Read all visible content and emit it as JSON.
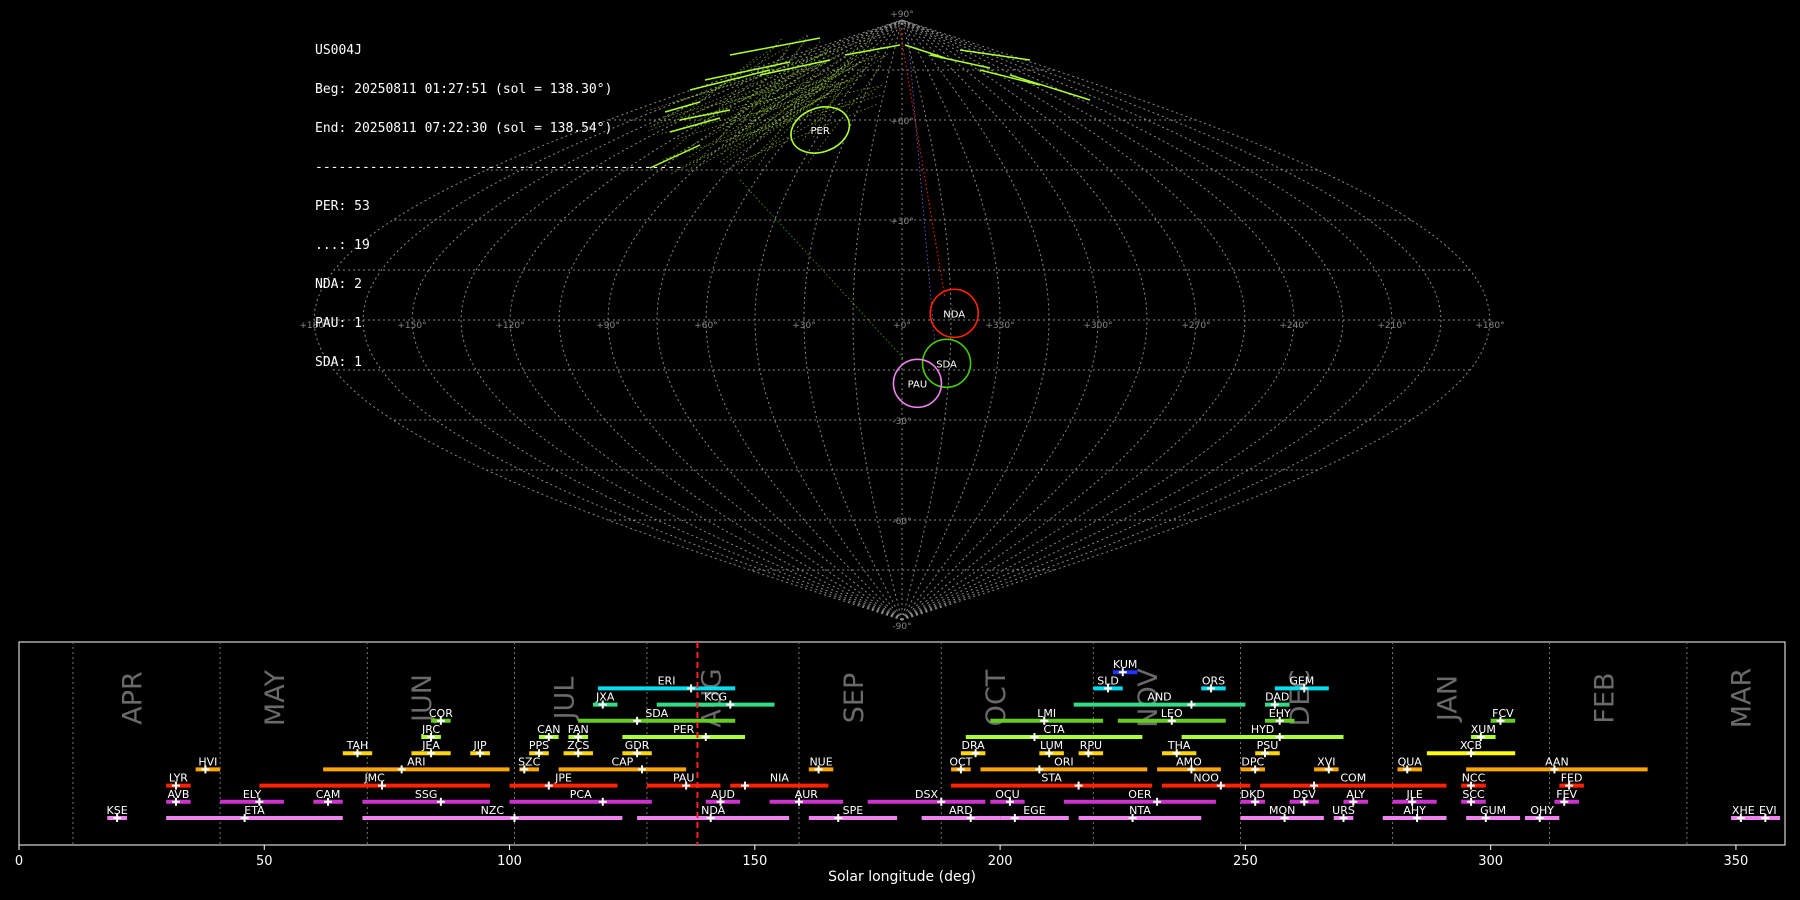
{
  "info": {
    "station": "US004J",
    "begin": "Beg: 20250811 01:27:51 (sol = 138.30°)",
    "end": "End: 20250811 07:22:30 (sol = 138.54°)",
    "separator": "-----------------------------------------------",
    "counts": [
      "PER: 53",
      "...: 19",
      "NDA: 2",
      "PAU: 1",
      "SDA: 1"
    ]
  },
  "sky": {
    "lon_labels": [
      "+180°",
      "+150°",
      "+120°",
      "+90°",
      "+60°",
      "+30°",
      "+0°",
      "+330°",
      "+300°",
      "+270°",
      "+240°",
      "+210°",
      "+180°"
    ],
    "lat_labels": [
      "+90°",
      "+60°",
      "+30°",
      "-30°",
      "-60°",
      "-90°"
    ],
    "radiants": [
      {
        "code": "PER",
        "lon": 46,
        "lat": 57,
        "color": "#adff2f"
      },
      {
        "code": "NDA",
        "lon": -16,
        "lat": 2,
        "color": "#ff2200"
      },
      {
        "code": "SDA",
        "lon": -14,
        "lat": -13,
        "color": "#44cc00"
      },
      {
        "code": "PAU",
        "lon": -5,
        "lat": -19,
        "color": "#ee82ee"
      }
    ]
  },
  "chart_data": {
    "type": "timeline",
    "xlabel": "Solar longitude (deg)",
    "xlim": [
      0,
      360
    ],
    "xticks": [
      0,
      50,
      100,
      150,
      200,
      250,
      300,
      350
    ],
    "current_sol": 138.3,
    "months": [
      {
        "name": "APR",
        "sol": 25
      },
      {
        "name": "MAY",
        "sol": 54
      },
      {
        "name": "JUN",
        "sol": 84
      },
      {
        "name": "JUL",
        "sol": 113
      },
      {
        "name": "AUG",
        "sol": 143
      },
      {
        "name": "SEP",
        "sol": 172
      },
      {
        "name": "OCT",
        "sol": 201
      },
      {
        "name": "NOV",
        "sol": 232
      },
      {
        "name": "DEC",
        "sol": 263
      },
      {
        "name": "JAN",
        "sol": 293
      },
      {
        "name": "FEB",
        "sol": 325
      },
      {
        "name": "MAR",
        "sol": 353
      }
    ],
    "month_dividers": [
      11,
      41,
      71,
      101,
      128,
      159,
      188,
      219,
      249,
      280,
      312,
      340
    ],
    "showers": [
      {
        "code": "KSE",
        "start": 18,
        "end": 22,
        "peak": 20,
        "row": 0,
        "color": "#ee82ee"
      },
      {
        "code": "ETA",
        "start": 30,
        "end": 66,
        "peak": 46,
        "row": 0,
        "color": "#ee82ee"
      },
      {
        "code": "NZC",
        "start": 70,
        "end": 123,
        "peak": 101,
        "row": 0,
        "color": "#ee82ee"
      },
      {
        "code": "NDA",
        "start": 126,
        "end": 157,
        "peak": 141,
        "row": 0,
        "color": "#ee82ee"
      },
      {
        "code": "SPE",
        "start": 161,
        "end": 179,
        "peak": 167,
        "row": 0,
        "color": "#ee82ee"
      },
      {
        "code": "ARD",
        "start": 184,
        "end": 200,
        "peak": 194,
        "row": 0,
        "color": "#ee82ee"
      },
      {
        "code": "EGE",
        "start": 200,
        "end": 214,
        "peak": 203,
        "row": 0,
        "color": "#ee82ee"
      },
      {
        "code": "NTA",
        "start": 216,
        "end": 241,
        "peak": 227,
        "row": 0,
        "color": "#ee82ee"
      },
      {
        "code": "MON",
        "start": 249,
        "end": 266,
        "peak": 258,
        "row": 0,
        "color": "#ee82ee"
      },
      {
        "code": "URS",
        "start": 268,
        "end": 272,
        "peak": 270,
        "row": 0,
        "color": "#ee82ee"
      },
      {
        "code": "AHY",
        "start": 278,
        "end": 291,
        "peak": 285,
        "row": 0,
        "color": "#ee82ee"
      },
      {
        "code": "GUM",
        "start": 295,
        "end": 306,
        "peak": 299,
        "row": 0,
        "color": "#ee82ee"
      },
      {
        "code": "OHY",
        "start": 307,
        "end": 314,
        "peak": 310,
        "row": 0,
        "color": "#ee82ee"
      },
      {
        "code": "XHE",
        "start": 349,
        "end": 354,
        "peak": 351,
        "row": 0,
        "color": "#ee82ee"
      },
      {
        "code": "EVI",
        "start": 354,
        "end": 359,
        "peak": 356,
        "row": 0,
        "color": "#ee82ee"
      },
      {
        "code": "AVB",
        "start": 30,
        "end": 35,
        "peak": 32,
        "row": 1,
        "color": "#cc33cc"
      },
      {
        "code": "ELY",
        "start": 41,
        "end": 54,
        "peak": 49,
        "row": 1,
        "color": "#cc33cc"
      },
      {
        "code": "CAM",
        "start": 60,
        "end": 66,
        "peak": 63,
        "row": 1,
        "color": "#cc33cc"
      },
      {
        "code": "SSG",
        "start": 70,
        "end": 96,
        "peak": 86,
        "row": 1,
        "color": "#cc33cc"
      },
      {
        "code": "PCA",
        "start": 100,
        "end": 129,
        "peak": 119,
        "row": 1,
        "color": "#cc33cc"
      },
      {
        "code": "AUD",
        "start": 140,
        "end": 147,
        "peak": 143,
        "row": 1,
        "color": "#cc33cc"
      },
      {
        "code": "AUR",
        "start": 153,
        "end": 168,
        "peak": 159,
        "row": 1,
        "color": "#cc33cc"
      },
      {
        "code": "DSX",
        "start": 173,
        "end": 197,
        "peak": 188,
        "row": 1,
        "color": "#cc33cc"
      },
      {
        "code": "OCU",
        "start": 198,
        "end": 205,
        "peak": 202,
        "row": 1,
        "color": "#cc33cc"
      },
      {
        "code": "OER",
        "start": 213,
        "end": 244,
        "peak": 232,
        "row": 1,
        "color": "#cc33cc"
      },
      {
        "code": "DKD",
        "start": 249,
        "end": 254,
        "peak": 252,
        "row": 1,
        "color": "#cc33cc"
      },
      {
        "code": "DSV",
        "start": 259,
        "end": 265,
        "peak": 262,
        "row": 1,
        "color": "#cc33cc"
      },
      {
        "code": "ALY",
        "start": 270,
        "end": 275,
        "peak": 272,
        "row": 1,
        "color": "#cc33cc"
      },
      {
        "code": "JLE",
        "start": 280,
        "end": 289,
        "peak": 284,
        "row": 1,
        "color": "#cc33cc"
      },
      {
        "code": "SCC",
        "start": 294,
        "end": 299,
        "peak": 296,
        "row": 1,
        "color": "#cc33cc"
      },
      {
        "code": "FEV",
        "start": 313,
        "end": 318,
        "peak": 315,
        "row": 1,
        "color": "#cc33cc"
      },
      {
        "code": "LYR",
        "start": 30,
        "end": 35,
        "peak": 32,
        "row": 2,
        "color": "#ff2200"
      },
      {
        "code": "JMC",
        "start": 49,
        "end": 96,
        "peak": 74,
        "row": 2,
        "color": "#ff2200"
      },
      {
        "code": "JPE",
        "start": 100,
        "end": 122,
        "peak": 108,
        "row": 2,
        "color": "#ff2200"
      },
      {
        "code": "PAU",
        "start": 128,
        "end": 143,
        "peak": 136,
        "row": 2,
        "color": "#ff2200"
      },
      {
        "code": "NIA",
        "start": 145,
        "end": 165,
        "peak": 148,
        "row": 2,
        "color": "#ff2200"
      },
      {
        "code": "STA",
        "start": 190,
        "end": 231,
        "peak": 216,
        "row": 2,
        "color": "#ff2200"
      },
      {
        "code": "NOO",
        "start": 233,
        "end": 251,
        "peak": 245,
        "row": 2,
        "color": "#ff2200"
      },
      {
        "code": "COM",
        "start": 253,
        "end": 291,
        "peak": 264,
        "row": 2,
        "color": "#ff2200"
      },
      {
        "code": "NCC",
        "start": 294,
        "end": 299,
        "peak": 296,
        "row": 2,
        "color": "#ff2200"
      },
      {
        "code": "FED",
        "start": 314,
        "end": 319,
        "peak": 316,
        "row": 2,
        "color": "#ff2200"
      },
      {
        "code": "HVI",
        "start": 36,
        "end": 41,
        "peak": 38,
        "row": 3,
        "color": "#ffa500"
      },
      {
        "code": "ARI",
        "start": 62,
        "end": 100,
        "peak": 78,
        "row": 3,
        "color": "#ffa500"
      },
      {
        "code": "SZC",
        "start": 102,
        "end": 106,
        "peak": 103,
        "row": 3,
        "color": "#ffa500"
      },
      {
        "code": "CAP",
        "start": 110,
        "end": 136,
        "peak": 127,
        "row": 3,
        "color": "#ffa500"
      },
      {
        "code": "NUE",
        "start": 161,
        "end": 166,
        "peak": 163,
        "row": 3,
        "color": "#ffa500"
      },
      {
        "code": "OCT",
        "start": 190,
        "end": 194,
        "peak": 192,
        "row": 3,
        "color": "#ffa500"
      },
      {
        "code": "ORI",
        "start": 196,
        "end": 230,
        "peak": 208,
        "row": 3,
        "color": "#ffa500"
      },
      {
        "code": "AMO",
        "start": 232,
        "end": 245,
        "peak": 239,
        "row": 3,
        "color": "#ffa500"
      },
      {
        "code": "DPC",
        "start": 249,
        "end": 254,
        "peak": 252,
        "row": 3,
        "color": "#ffa500"
      },
      {
        "code": "XVI",
        "start": 264,
        "end": 269,
        "peak": 267,
        "row": 3,
        "color": "#ffa500"
      },
      {
        "code": "QUA",
        "start": 281,
        "end": 286,
        "peak": 283,
        "row": 3,
        "color": "#ffa500"
      },
      {
        "code": "AAN",
        "start": 295,
        "end": 332,
        "peak": 313,
        "row": 3,
        "color": "#ffa500"
      },
      {
        "code": "TAH",
        "start": 66,
        "end": 72,
        "peak": 69,
        "row": 4,
        "color": "#ffd700"
      },
      {
        "code": "JEA",
        "start": 80,
        "end": 88,
        "peak": 84,
        "row": 4,
        "color": "#ffd700"
      },
      {
        "code": "JIP",
        "start": 92,
        "end": 96,
        "peak": 94,
        "row": 4,
        "color": "#ffd700"
      },
      {
        "code": "PPS",
        "start": 104,
        "end": 108,
        "peak": 106,
        "row": 4,
        "color": "#ffd700"
      },
      {
        "code": "ZCS",
        "start": 111,
        "end": 117,
        "peak": 114,
        "row": 4,
        "color": "#ffd700"
      },
      {
        "code": "GDR",
        "start": 123,
        "end": 129,
        "peak": 126,
        "row": 4,
        "color": "#ffd700"
      },
      {
        "code": "DRA",
        "start": 192,
        "end": 197,
        "peak": 195,
        "row": 4,
        "color": "#ffd700"
      },
      {
        "code": "LUM",
        "start": 208,
        "end": 213,
        "peak": 210,
        "row": 4,
        "color": "#ffd700"
      },
      {
        "code": "RPU",
        "start": 216,
        "end": 221,
        "peak": 218,
        "row": 4,
        "color": "#ffd700"
      },
      {
        "code": "THA",
        "start": 233,
        "end": 240,
        "peak": 236,
        "row": 4,
        "color": "#ffd700"
      },
      {
        "code": "PSU",
        "start": 252,
        "end": 257,
        "peak": 254,
        "row": 4,
        "color": "#ffd700"
      },
      {
        "code": "XCB",
        "start": 287,
        "end": 305,
        "peak": 296,
        "row": 4,
        "color": "#ffff00"
      },
      {
        "code": "JRC",
        "start": 82,
        "end": 86,
        "peak": 84,
        "row": 5,
        "color": "#adff2f"
      },
      {
        "code": "CAN",
        "start": 106,
        "end": 110,
        "peak": 108,
        "row": 5,
        "color": "#adff2f"
      },
      {
        "code": "FAN",
        "start": 112,
        "end": 116,
        "peak": 114,
        "row": 5,
        "color": "#adff2f"
      },
      {
        "code": "PER",
        "start": 123,
        "end": 148,
        "peak": 140,
        "row": 5,
        "color": "#adff2f"
      },
      {
        "code": "CTA",
        "start": 193,
        "end": 229,
        "peak": 207,
        "row": 5,
        "color": "#adff2f"
      },
      {
        "code": "HYD",
        "start": 237,
        "end": 270,
        "peak": 257,
        "row": 5,
        "color": "#adff2f"
      },
      {
        "code": "XUM",
        "start": 296,
        "end": 301,
        "peak": 298,
        "row": 5,
        "color": "#adff2f"
      },
      {
        "code": "COR",
        "start": 84,
        "end": 88,
        "peak": 86,
        "row": 6,
        "color": "#66cc22"
      },
      {
        "code": "SDA",
        "start": 114,
        "end": 146,
        "peak": 126,
        "row": 6,
        "color": "#66cc22"
      },
      {
        "code": "LMI",
        "start": 198,
        "end": 221,
        "peak": 209,
        "row": 6,
        "color": "#66cc22"
      },
      {
        "code": "LEO",
        "start": 224,
        "end": 246,
        "peak": 235,
        "row": 6,
        "color": "#66cc22"
      },
      {
        "code": "EHY",
        "start": 254,
        "end": 260,
        "peak": 257,
        "row": 6,
        "color": "#66cc22"
      },
      {
        "code": "FCV",
        "start": 300,
        "end": 305,
        "peak": 302,
        "row": 6,
        "color": "#66cc22"
      },
      {
        "code": "JXA",
        "start": 117,
        "end": 122,
        "peak": 119,
        "row": 7,
        "color": "#33dd88"
      },
      {
        "code": "KCG",
        "start": 130,
        "end": 154,
        "peak": 145,
        "row": 7,
        "color": "#33dd88"
      },
      {
        "code": "AND",
        "start": 215,
        "end": 250,
        "peak": 239,
        "row": 7,
        "color": "#33dd88"
      },
      {
        "code": "DAD",
        "start": 254,
        "end": 259,
        "peak": 256,
        "row": 7,
        "color": "#33dd88"
      },
      {
        "code": "ERI",
        "start": 118,
        "end": 146,
        "peak": 137,
        "row": 8,
        "color": "#00ddee"
      },
      {
        "code": "SLD",
        "start": 219,
        "end": 225,
        "peak": 222,
        "row": 8,
        "color": "#00ddee"
      },
      {
        "code": "ORS",
        "start": 241,
        "end": 246,
        "peak": 243,
        "row": 8,
        "color": "#00ddee"
      },
      {
        "code": "GEM",
        "start": 256,
        "end": 267,
        "peak": 262,
        "row": 8,
        "color": "#00ddee"
      },
      {
        "code": "KUM",
        "start": 223,
        "end": 228,
        "peak": 225,
        "row": 9,
        "color": "#2233ff"
      }
    ]
  }
}
